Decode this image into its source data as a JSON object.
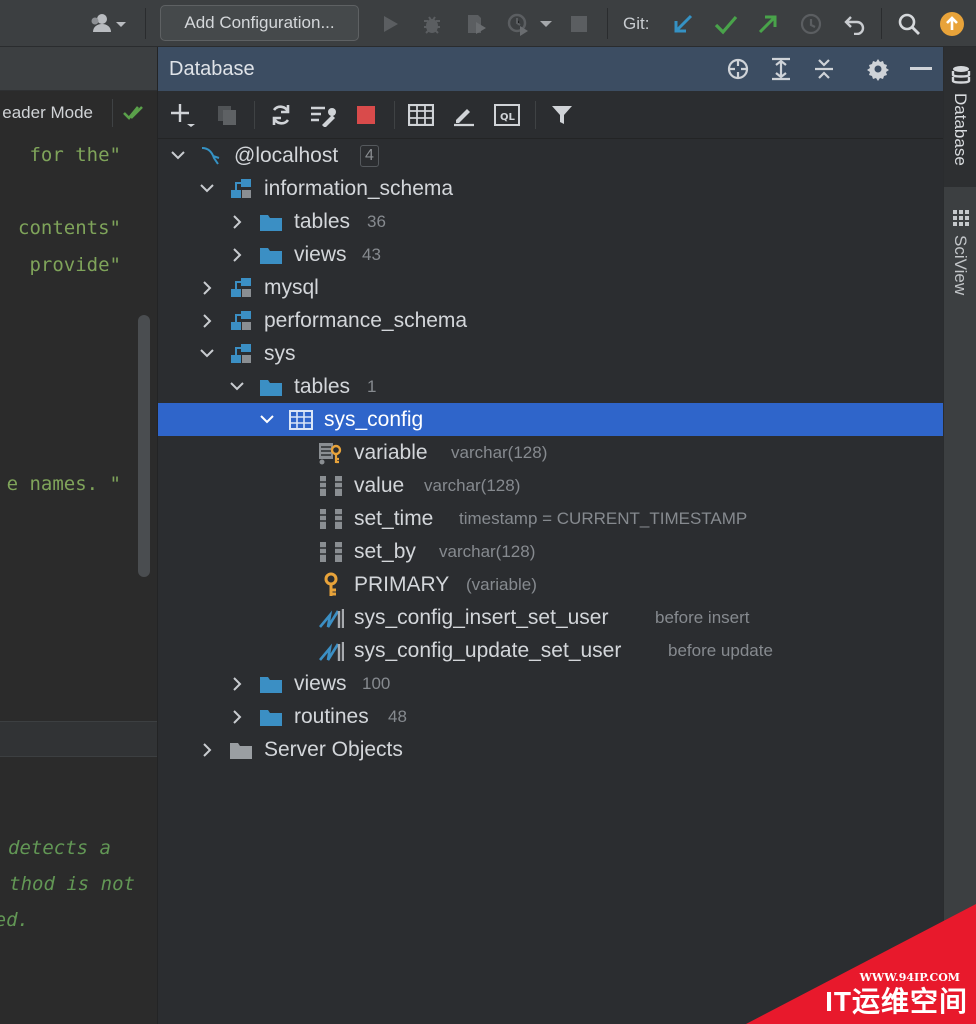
{
  "toolbar": {
    "add_configuration": "Add Configuration...",
    "git_label": "Git:"
  },
  "editor": {
    "reader_mode": "eader Mode",
    "code_lines": [
      "for the\"",
      "contents\"",
      "provide\"",
      "e names. \"",
      "detects a",
      "thod is not",
      "ed."
    ]
  },
  "db_panel": {
    "title": "Database",
    "tree": [
      {
        "label": "@localhost",
        "badge": "4",
        "meta": "",
        "icon": "mysql-connection-icon"
      },
      {
        "label": "information_schema",
        "meta": "",
        "icon": "schema-icon"
      },
      {
        "label": "tables",
        "meta": "36",
        "icon": "folder-icon"
      },
      {
        "label": "views",
        "meta": "43",
        "icon": "folder-icon"
      },
      {
        "label": "mysql",
        "meta": "",
        "icon": "schema-icon"
      },
      {
        "label": "performance_schema",
        "meta": "",
        "icon": "schema-icon"
      },
      {
        "label": "sys",
        "meta": "",
        "icon": "schema-icon"
      },
      {
        "label": "tables",
        "meta": "1",
        "icon": "folder-icon"
      },
      {
        "label": "sys_config",
        "meta": "",
        "icon": "table-icon"
      },
      {
        "label": "variable",
        "meta": "varchar(128)",
        "icon": "primary-key-column-icon"
      },
      {
        "label": "value",
        "meta": "varchar(128)",
        "icon": "column-icon"
      },
      {
        "label": "set_time",
        "meta": "timestamp = CURRENT_TIMESTAMP",
        "icon": "column-icon"
      },
      {
        "label": "set_by",
        "meta": "varchar(128)",
        "icon": "column-icon"
      },
      {
        "label": "PRIMARY",
        "meta": "(variable)",
        "icon": "key-icon"
      },
      {
        "label": "sys_config_insert_set_user",
        "meta": "before insert",
        "icon": "trigger-icon"
      },
      {
        "label": "sys_config_update_set_user",
        "meta": "before update",
        "icon": "trigger-icon"
      },
      {
        "label": "views",
        "meta": "100",
        "icon": "folder-icon"
      },
      {
        "label": "routines",
        "meta": "48",
        "icon": "folder-icon"
      },
      {
        "label": "Server Objects",
        "meta": "",
        "icon": "server-objects-folder-icon"
      }
    ]
  },
  "right_strip": {
    "tabs": [
      "Database",
      "SciView"
    ]
  },
  "watermark": {
    "url": "WWW.94IP.COM",
    "name": "IT运维空间"
  },
  "colors": {
    "selection": "#2f65ca",
    "header_active": "#3c4d62",
    "folder": "#3b8fc4",
    "code_string": "#7fa45a",
    "git_update": "#3592c4",
    "git_commit": "#49a34a"
  }
}
